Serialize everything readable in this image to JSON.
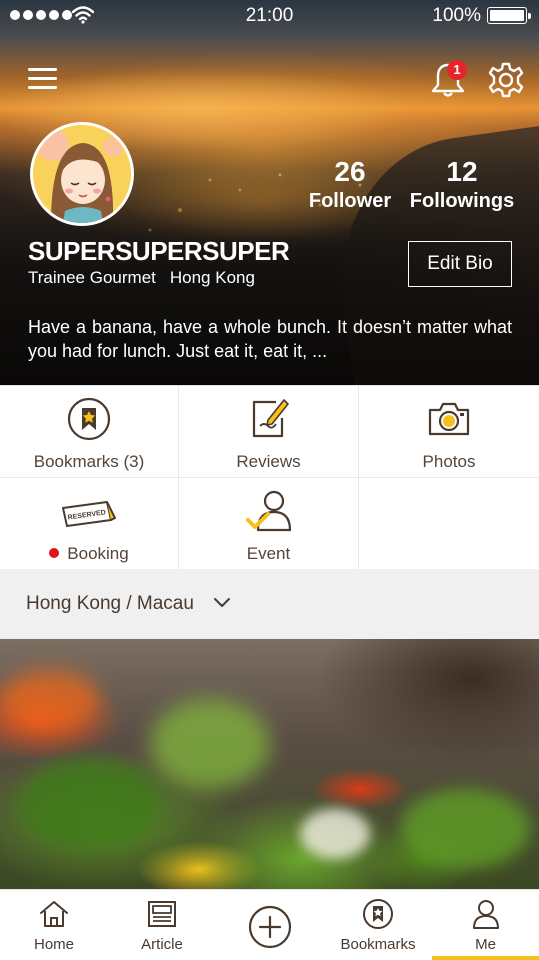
{
  "status_bar": {
    "time": "21:00",
    "battery_percent": "100%",
    "battery_level": 1.0,
    "signal_dots": 5,
    "wifi_icon": "wifi-icon"
  },
  "header": {
    "menu_icon": "hamburger-icon",
    "notification_icon": "bell-icon",
    "notification_count": "1",
    "settings_icon": "gear-icon"
  },
  "profile": {
    "avatar_icon": "avatar-girl-illustration",
    "follower_count": "26",
    "follower_label": "Follower",
    "following_count": "12",
    "following_label": "Followings",
    "username": "SUPERSUPERSUPER",
    "level": "Trainee Gourmet",
    "location": "Hong Kong",
    "edit_bio_label": "Edit Bio",
    "bio": "Have a banana, have a whole bunch. It doesn’t matter what you had for lunch. Just eat it, eat it, ..."
  },
  "menu_grid": {
    "items": [
      {
        "label": "Bookmarks (3)",
        "icon": "bookmark-star-icon"
      },
      {
        "label": "Reviews",
        "icon": "review-pen-icon"
      },
      {
        "label": "Photos",
        "icon": "camera-icon"
      },
      {
        "label": "Booking",
        "icon": "reserved-sign-icon",
        "has_alert_dot": true
      },
      {
        "label": "Event",
        "icon": "user-check-icon"
      }
    ]
  },
  "region_selector": {
    "label": "Hong Kong / Macau",
    "icon": "chevron-down-icon"
  },
  "tab_bar": {
    "items": [
      {
        "label": "Home",
        "icon": "home-icon"
      },
      {
        "label": "Article",
        "icon": "article-icon"
      },
      {
        "label": "",
        "icon": "add-circle-icon"
      },
      {
        "label": "Bookmarks",
        "icon": "bookmark-star-icon"
      },
      {
        "label": "Me",
        "icon": "user-icon",
        "active": true
      }
    ]
  },
  "colors": {
    "accent": "#f7c01d",
    "text_brown": "#4a3a2e",
    "alert_red": "#e8242b",
    "region_bg": "#f0f0f0"
  }
}
